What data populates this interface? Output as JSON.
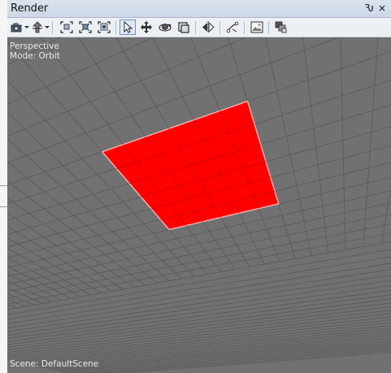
{
  "panel": {
    "title": "Render",
    "pin_glyph": "Ԅ",
    "close_glyph": "×"
  },
  "toolbar": {
    "buttons": [
      {
        "name": "camera-icon"
      },
      {
        "name": "up-axis-icon"
      },
      {
        "name": "zoom-extents-icon"
      },
      {
        "name": "zoom-selected-icon"
      },
      {
        "name": "zoom-all-icon"
      },
      {
        "name": "select-cursor-icon"
      },
      {
        "name": "move-icon"
      },
      {
        "name": "orbit-icon"
      },
      {
        "name": "frame-icon"
      },
      {
        "name": "mirror-icon"
      },
      {
        "name": "pick-icon"
      },
      {
        "name": "image-icon"
      },
      {
        "name": "layers-icon"
      }
    ],
    "active": "select-cursor-icon"
  },
  "viewport": {
    "view_label": "Perspective",
    "mode_label": "Mode: Orbit",
    "scene_label": "Scene: DefaultScene",
    "colors": {
      "background": "#717171",
      "grid": "#595959",
      "plane": "#ff0000",
      "plane_grid": "#d40000",
      "plane_edge": "#ffb0b0"
    }
  }
}
